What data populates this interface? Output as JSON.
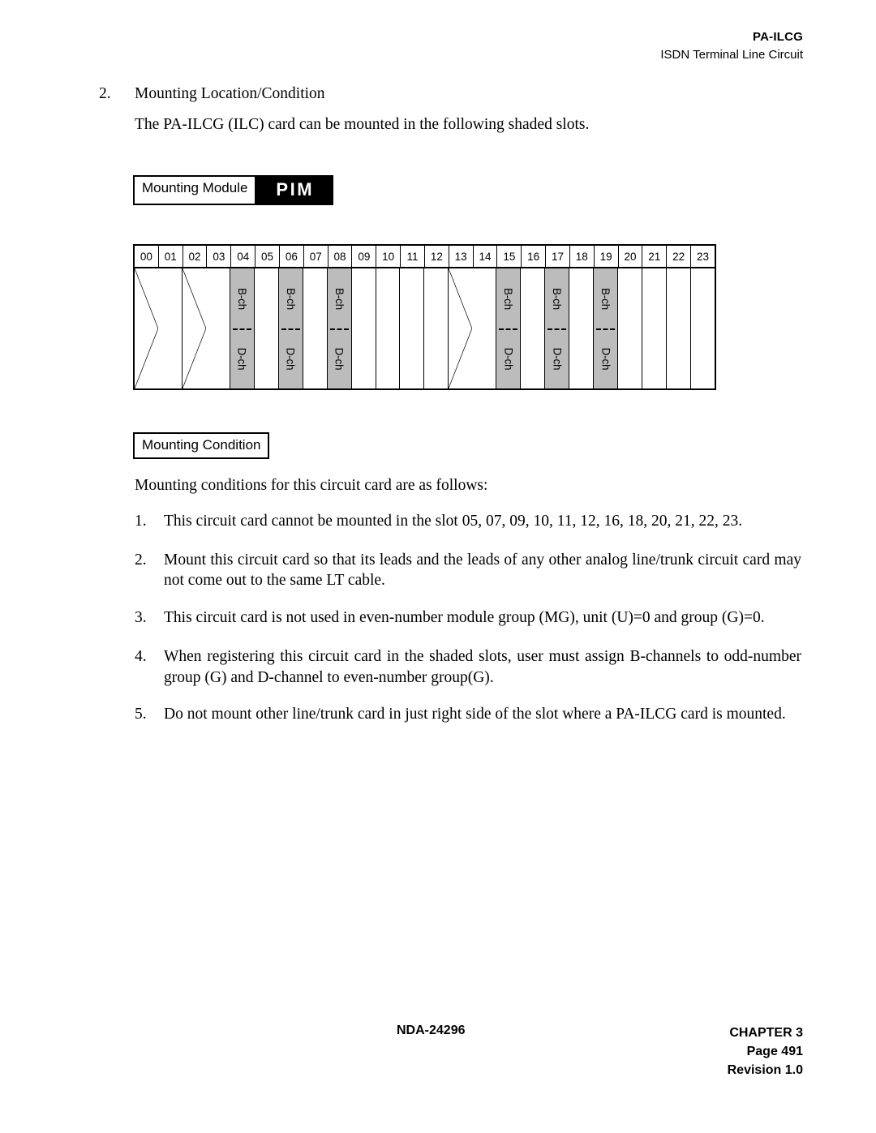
{
  "header": {
    "code": "PA-ILCG",
    "subtitle": "ISDN Terminal Line Circuit"
  },
  "section": {
    "number": "2.",
    "title": "Mounting Location/Condition",
    "intro": "The PA-ILCG (ILC) card can be mounted in the following shaded slots."
  },
  "mounting_module": {
    "label": "Mounting Module",
    "value": "PIM"
  },
  "slot_diagram": {
    "slot_numbers": [
      "00",
      "01",
      "02",
      "03",
      "04",
      "05",
      "06",
      "07",
      "08",
      "09",
      "10",
      "11",
      "12",
      "13",
      "14",
      "15",
      "16",
      "17",
      "18",
      "19",
      "20",
      "21",
      "22",
      "23"
    ],
    "b_channel_label": "B-ch",
    "d_channel_label": "D-ch",
    "shaded_slots": [
      "04",
      "06",
      "08",
      "15",
      "17",
      "19"
    ],
    "crossed_slot_pairs": [
      [
        "00",
        "01"
      ],
      [
        "02",
        "03"
      ],
      [
        "13",
        "14"
      ]
    ],
    "empty_slots": [
      "05",
      "07",
      "09",
      "10",
      "11",
      "12",
      "16",
      "18",
      "20",
      "21",
      "22",
      "23"
    ],
    "shade_color": "#bcbcbc"
  },
  "mounting_condition": {
    "label": "Mounting Condition",
    "intro": "Mounting conditions for this circuit card are as follows:",
    "items": [
      {
        "num": "1.",
        "text": "This circuit card cannot be mounted in the slot 05, 07, 09, 10, 11, 12, 16, 18, 20, 21, 22, 23."
      },
      {
        "num": "2.",
        "text": "Mount this circuit card so that its leads and the leads of any other analog line/trunk circuit card may not come out to the same LT cable."
      },
      {
        "num": "3.",
        "text": "This circuit card is not used in even-number module group (MG), unit (U)=0 and group (G)=0."
      },
      {
        "num": "4.",
        "text": "When registering this circuit card in the shaded slots, user must assign B-channels to odd-number group (G) and D-channel to even-number group(G)."
      },
      {
        "num": "5.",
        "text": "Do not mount other line/trunk card in just right side of the slot where a PA-ILCG card is mounted."
      }
    ]
  },
  "footer": {
    "document_number": "NDA-24296",
    "chapter": "CHAPTER 3",
    "page": "Page 491",
    "revision": "Revision 1.0"
  }
}
